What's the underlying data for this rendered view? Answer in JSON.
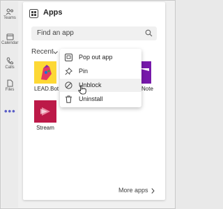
{
  "rail": {
    "items": [
      {
        "label": "Teams",
        "icon": "teams-icon"
      },
      {
        "label": "Calendar",
        "icon": "calendar-icon"
      },
      {
        "label": "Calls",
        "icon": "phone-icon"
      },
      {
        "label": "Files",
        "icon": "file-icon"
      }
    ],
    "more": "•••"
  },
  "panel": {
    "title": "Apps",
    "search_placeholder": "Find an app",
    "filter_label": "Recent",
    "apps": [
      {
        "label": "LEAD.Bot",
        "icon": "lead-bot-icon",
        "color": "#fdd835"
      },
      {
        "label": "Note",
        "icon": "onenote-icon",
        "color": "#7719aa"
      },
      {
        "label": "Stream",
        "icon": "stream-icon",
        "color": "#bc1948"
      }
    ],
    "more_apps": "More apps"
  },
  "context_menu": {
    "items": [
      {
        "label": "Pop out app",
        "icon": "pop-out-icon"
      },
      {
        "label": "Pin",
        "icon": "pin-icon"
      },
      {
        "label": "Unblock",
        "icon": "unblock-icon"
      },
      {
        "label": "Uninstall",
        "icon": "trash-icon"
      }
    ]
  },
  "colors": {
    "accent": "#5b5fc7",
    "panel_bg": "#ffffff",
    "window_bg": "#f0f0f0"
  }
}
